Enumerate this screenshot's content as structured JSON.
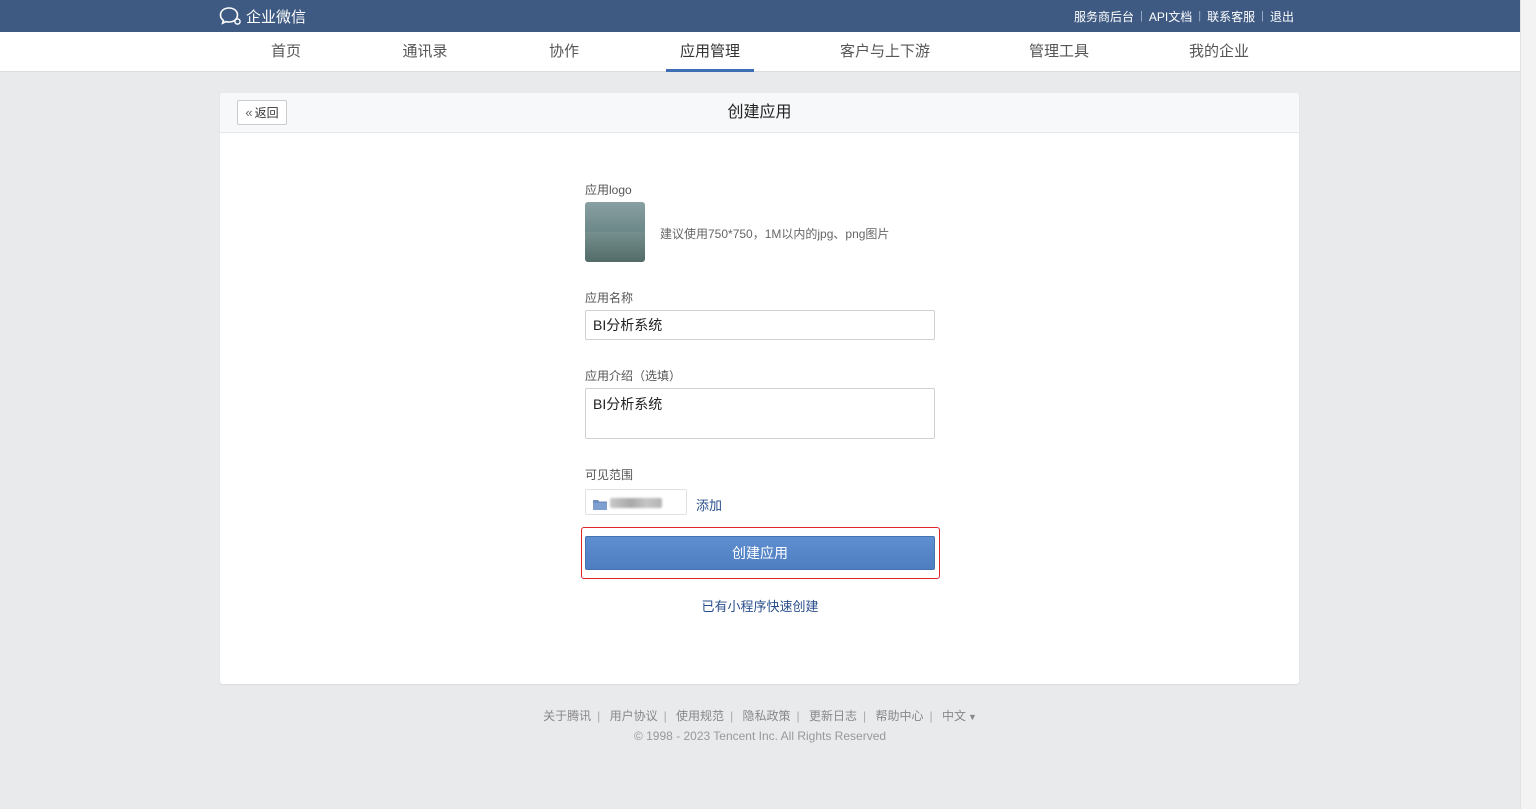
{
  "brand": {
    "name": "企业微信",
    "icon": "chat-bubble-icon"
  },
  "top_links": [
    {
      "label": "服务商后台"
    },
    {
      "label": "API文档"
    },
    {
      "label": "联系客服"
    },
    {
      "label": "退出"
    }
  ],
  "nav": {
    "items": [
      {
        "label": "首页"
      },
      {
        "label": "通讯录"
      },
      {
        "label": "协作"
      },
      {
        "label": "应用管理"
      },
      {
        "label": "客户与上下游"
      },
      {
        "label": "管理工具"
      },
      {
        "label": "我的企业"
      }
    ],
    "active": "应用管理"
  },
  "card": {
    "back_label": "返回",
    "title": "创建应用"
  },
  "form": {
    "logo_label": "应用logo",
    "logo_hint": "建议使用750*750，1M以内的jpg、png图片",
    "name_label": "应用名称",
    "name_value": "BI分析系统",
    "desc_label": "应用介绍（选填）",
    "desc_value": "BI分析系统",
    "scope_label": "可见范围",
    "add_label": "添加",
    "submit_label": "创建应用",
    "quick_create_label": "已有小程序快速创建"
  },
  "footer": {
    "links": [
      {
        "label": "关于腾讯"
      },
      {
        "label": "用户协议"
      },
      {
        "label": "使用规范"
      },
      {
        "label": "隐私政策"
      },
      {
        "label": "更新日志"
      },
      {
        "label": "帮助中心"
      },
      {
        "label": "中文"
      }
    ],
    "copyright": "© 1998 - 2023 Tencent Inc. All Rights Reserved"
  },
  "colors": {
    "topbar": "#3e5a82",
    "primary": "#4e7ec0",
    "link": "#2a4e8c",
    "highlight": "#e0262b"
  }
}
